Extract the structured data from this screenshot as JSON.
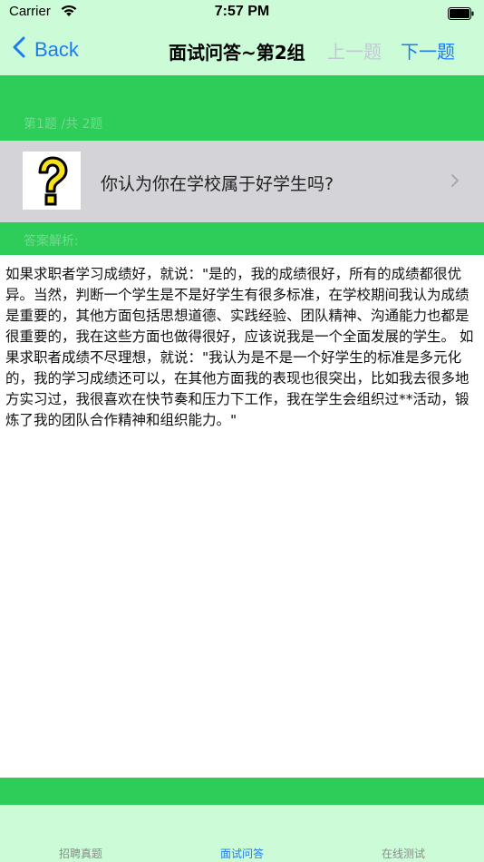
{
  "status_bar": {
    "carrier": "Carrier",
    "time": "7:57 PM",
    "wifi_icon": "wifi-icon",
    "battery_icon": "battery-icon"
  },
  "nav": {
    "back_label": "Back",
    "title": "面试问答~第2组",
    "prev_label": "上一题",
    "next_label": "下一题"
  },
  "question": {
    "counter": "第1题 /共 2题",
    "text": "你认为你在学校属于好学生吗?",
    "icon": "question-mark-icon"
  },
  "answer": {
    "label": "答案解析:",
    "body": "如果求职者学习成绩好，就说：\"是的，我的成绩很好，所有的成绩都很优异。当然，判断一个学生是不是好学生有很多标准，在学校期间我认为成绩是重要的，其他方面包括思想道德、实践经验、团队精神、沟通能力也都是很重要的，我在这些方面也做得很好，应该说我是一个全面发展的学生。 如果求职者成绩不尽理想，就说：\"我认为是不是一个好学生的标准是多元化的，我的学习成绩还可以，在其他方面我的表现也很突出，比如我去很多地方实习过，我很喜欢在快节奏和压力下工作，我在学生会组织过**活动，锻炼了我的团队合作精神和组织能力。\""
  },
  "tabs": [
    {
      "label": "招聘真题",
      "active": false
    },
    {
      "label": "面试问答",
      "active": true
    },
    {
      "label": "在线测试",
      "active": false
    }
  ],
  "colors": {
    "accent": "#1e7bf2",
    "green": "#2ecc58",
    "mint": "#ccfbd8",
    "disabled": "#bfcad2"
  }
}
